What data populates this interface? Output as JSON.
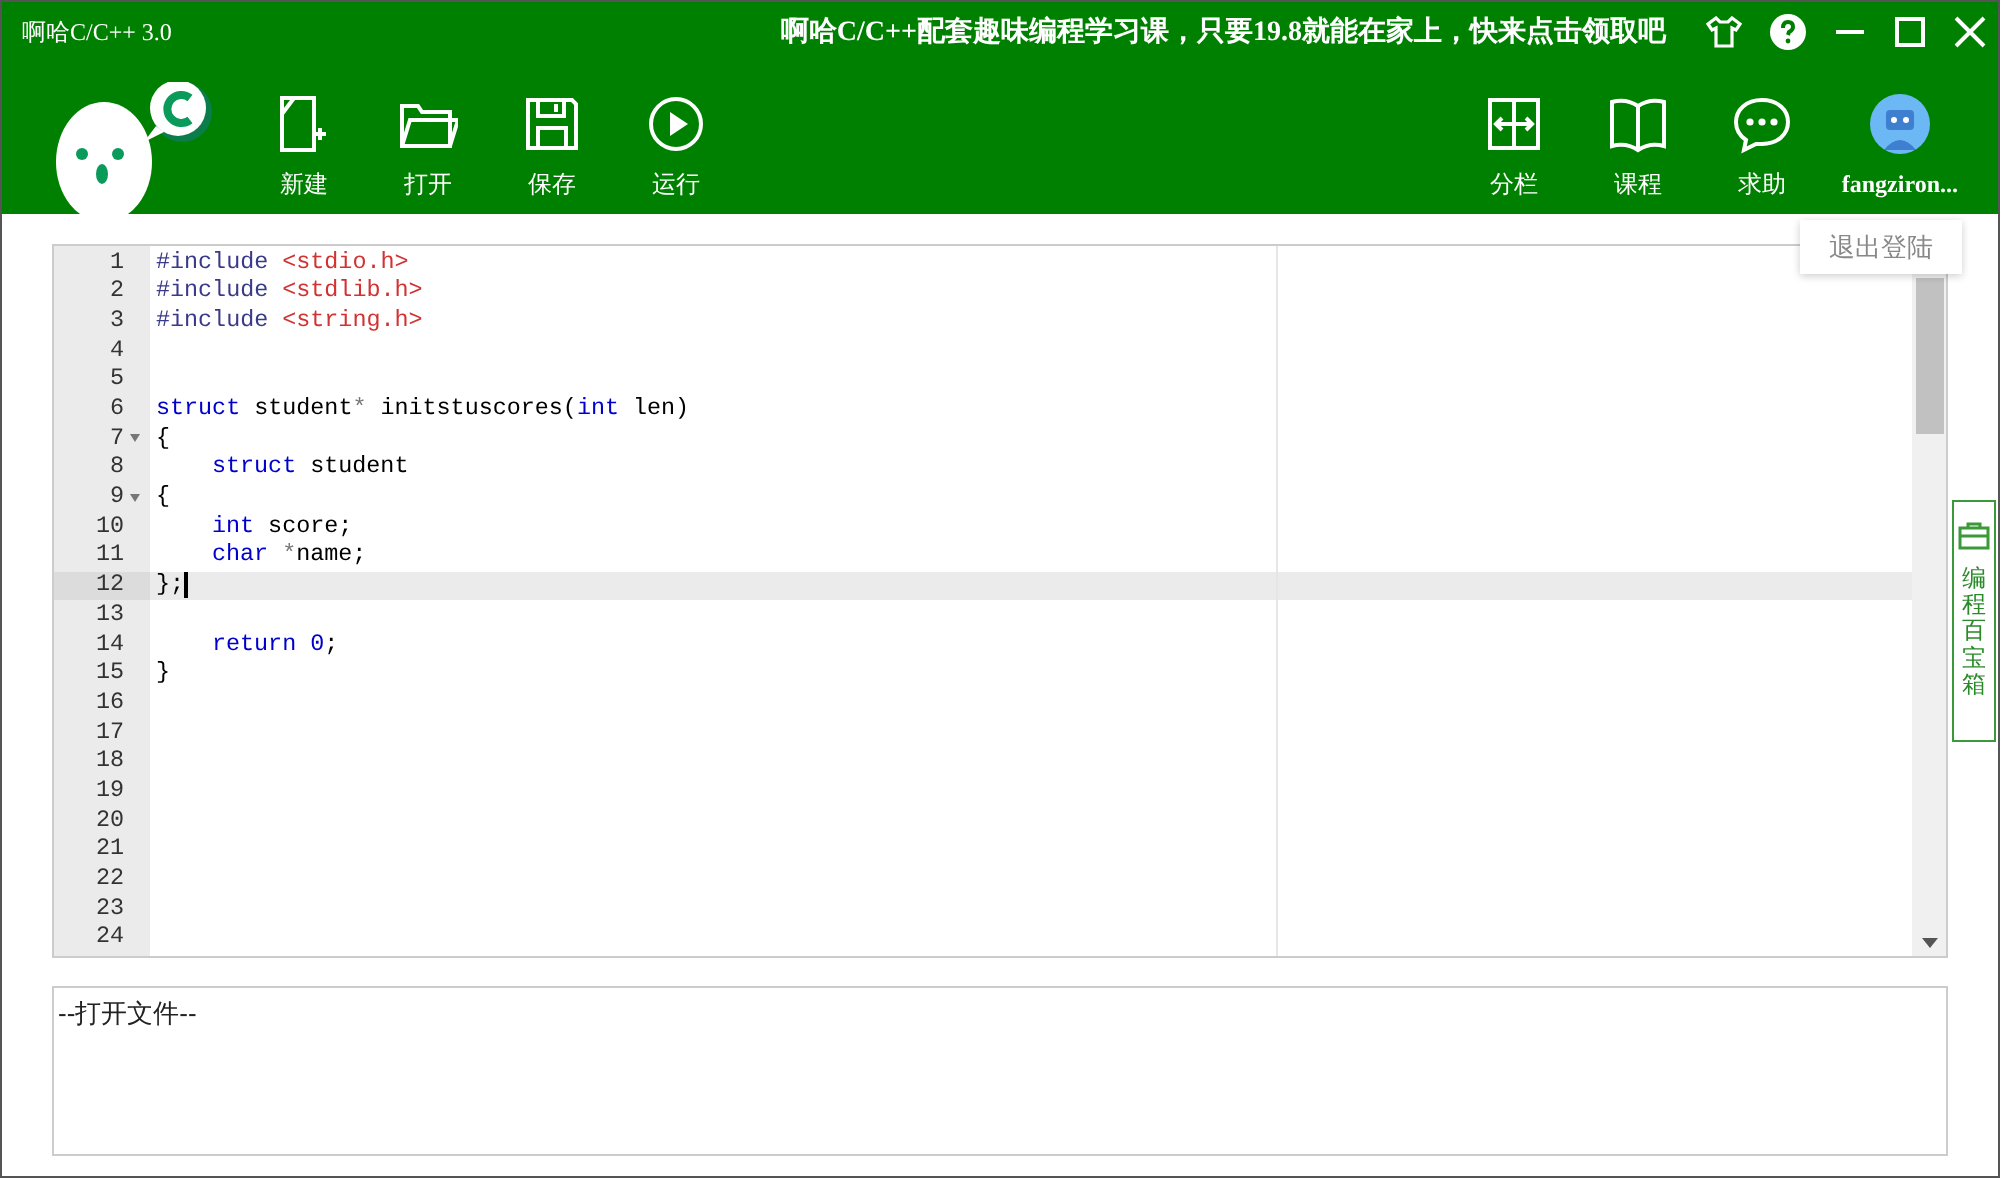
{
  "window": {
    "title": "啊哈C/C++ 3.0",
    "banner": "啊哈C/C++配套趣味编程学习课，只要19.8就能在家上，快来点击领取吧"
  },
  "toolbar_left": [
    {
      "label": "新建"
    },
    {
      "label": "打开"
    },
    {
      "label": "保存"
    },
    {
      "label": "运行"
    }
  ],
  "toolbar_right": [
    {
      "label": "分栏"
    },
    {
      "label": "课程"
    },
    {
      "label": "求助"
    }
  ],
  "user": {
    "name": "fangziron...",
    "menu_item": "退出登陆"
  },
  "editor": {
    "lines": [
      {
        "number": "1",
        "foldable": false,
        "current": false,
        "indented": false,
        "tokens": [
          {
            "kind": "directive",
            "text": "#include"
          },
          {
            "kind": "string",
            "text": " <stdio.h>"
          }
        ]
      },
      {
        "number": "2",
        "foldable": false,
        "current": false,
        "indented": false,
        "tokens": [
          {
            "kind": "directive",
            "text": "#include"
          },
          {
            "kind": "string",
            "text": " <stdlib.h>"
          }
        ]
      },
      {
        "number": "3",
        "foldable": false,
        "current": false,
        "indented": false,
        "tokens": [
          {
            "kind": "directive",
            "text": "#include"
          },
          {
            "kind": "string",
            "text": " <string.h>"
          }
        ]
      },
      {
        "number": "4",
        "foldable": false,
        "current": false
      },
      {
        "number": "5",
        "foldable": false,
        "current": false
      },
      {
        "number": "6",
        "foldable": false,
        "current": false,
        "indented": false,
        "tokens": [
          {
            "kind": "keyword",
            "text": "struct"
          },
          {
            "kind": "plain",
            "text": " student"
          },
          {
            "kind": "operator",
            "text": "*"
          },
          {
            "kind": "plain",
            "text": " initstuscores("
          },
          {
            "kind": "keyword",
            "text": "int"
          },
          {
            "kind": "plain",
            "text": " len)"
          }
        ]
      },
      {
        "number": "7",
        "foldable": true,
        "current": false,
        "indented": false,
        "tokens": [
          {
            "kind": "plain",
            "text": "{"
          }
        ]
      },
      {
        "number": "8",
        "foldable": false,
        "current": false,
        "indented": true,
        "tokens": [
          {
            "kind": "keyword",
            "text": "struct"
          },
          {
            "kind": "plain",
            "text": " student"
          }
        ]
      },
      {
        "number": "9",
        "foldable": true,
        "current": false,
        "indented": false,
        "tokens": [
          {
            "kind": "plain",
            "text": "{"
          }
        ]
      },
      {
        "number": "10",
        "foldable": false,
        "current": false,
        "indented": true,
        "tokens": [
          {
            "kind": "keyword",
            "text": "int"
          },
          {
            "kind": "plain",
            "text": " score;"
          }
        ]
      },
      {
        "number": "11",
        "foldable": false,
        "current": false,
        "indented": true,
        "tokens": [
          {
            "kind": "keyword",
            "text": "char"
          },
          {
            "kind": "operator",
            "text": " *"
          },
          {
            "kind": "plain",
            "text": "name;"
          }
        ]
      },
      {
        "number": "12",
        "foldable": false,
        "current": true,
        "indented": false,
        "tokens": [
          {
            "kind": "plain",
            "text": "};"
          }
        ]
      },
      {
        "number": "13",
        "foldable": false,
        "current": false
      },
      {
        "number": "14",
        "foldable": false,
        "current": false,
        "indented": true,
        "tokens": [
          {
            "kind": "keyword",
            "text": "return"
          },
          {
            "kind": "number",
            "text": " 0"
          },
          {
            "kind": "plain",
            "text": ";"
          }
        ]
      },
      {
        "number": "15",
        "foldable": false,
        "current": false,
        "indented": false,
        "tokens": [
          {
            "kind": "plain",
            "text": "}"
          }
        ]
      },
      {
        "number": "16",
        "foldable": false,
        "current": false
      },
      {
        "number": "17",
        "foldable": false,
        "current": false
      },
      {
        "number": "18",
        "foldable": false,
        "current": false
      },
      {
        "number": "19",
        "foldable": false,
        "current": false
      },
      {
        "number": "20",
        "foldable": false,
        "current": false
      },
      {
        "number": "21",
        "foldable": false,
        "current": false
      },
      {
        "number": "22",
        "foldable": false,
        "current": false
      },
      {
        "number": "23",
        "foldable": false,
        "current": false
      },
      {
        "number": "24",
        "foldable": false,
        "current": false
      }
    ]
  },
  "side_tab": {
    "label": "编程百宝箱"
  },
  "output": {
    "text": "--打开文件--"
  }
}
